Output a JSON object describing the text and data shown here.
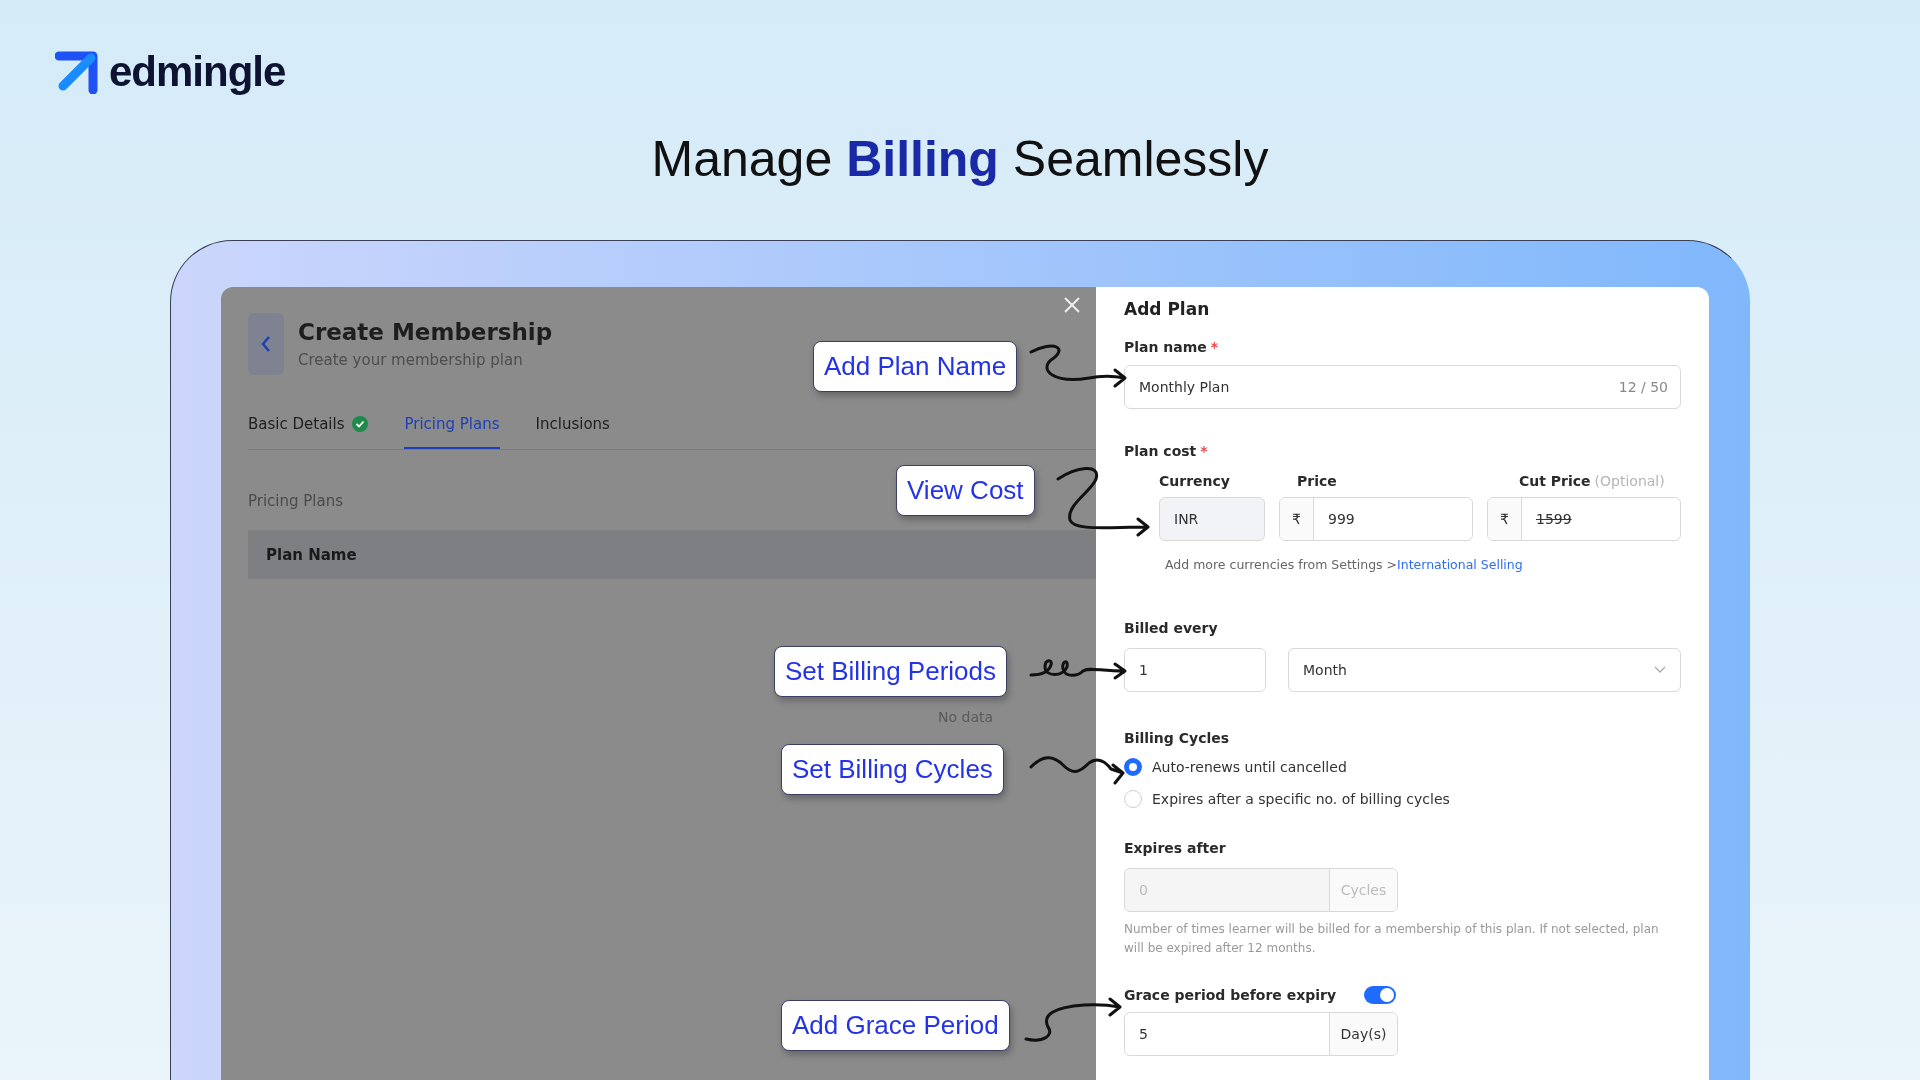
{
  "brand": {
    "name": "edmingle"
  },
  "headline": "Manage **Billing** Seamlessly",
  "membership": {
    "title": "Create Membership",
    "subtitle": "Create your membership plan",
    "tabs": [
      {
        "label": "Basic Details",
        "selected": false,
        "completed": true
      },
      {
        "label": "Pricing Plans",
        "selected": true,
        "completed": false
      },
      {
        "label": "Inclusions",
        "selected": false,
        "completed": false
      }
    ],
    "section_label": "Pricing Plans",
    "columns": [
      "Plan Name"
    ],
    "empty_text": "No data"
  },
  "callouts": [
    {
      "text": "Add Plan Name"
    },
    {
      "text": "View Cost"
    },
    {
      "text": "Set Billing Periods"
    },
    {
      "text": "Set Billing Cycles"
    },
    {
      "text": "Add Grace Period"
    }
  ],
  "add_plan": {
    "title": "Add Plan",
    "plan_name": {
      "label": "Plan name",
      "mark": "*",
      "value": "Monthly Plan",
      "counter": "12 / 50"
    },
    "plan_cost": {
      "label": "Plan cost",
      "mark": "*",
      "currency_label": "Currency",
      "currency": "INR",
      "price_label": "Price",
      "price_prefix": "₹",
      "price": "999",
      "cut_price_label": "Cut Price",
      "cut_price_hint": "(Optional)",
      "cut_price_prefix": "₹",
      "cut_price": "1599"
    },
    "note": "Add more currencies from Settings >",
    "note_link": "International Selling",
    "billed_every": {
      "label": "Billed every",
      "count": "1",
      "unit": "Month"
    },
    "billing_cycles": {
      "label": "Billing Cycles",
      "options": [
        {
          "label": "Auto-renews until cancelled",
          "selected": true
        },
        {
          "label": "Expires after a specific no. of billing cycles",
          "selected": false
        }
      ]
    },
    "expires_after": {
      "label": "Expires after",
      "placeholder": "0",
      "suffix": "Cycles",
      "disabled": true,
      "help": "Number of times learner will be billed for a membership of this plan. If not selected, plan will be expired after 12 months."
    },
    "grace": {
      "label": "Grace period before expiry",
      "on": true,
      "value": "5",
      "suffix": "Day(s)"
    }
  }
}
